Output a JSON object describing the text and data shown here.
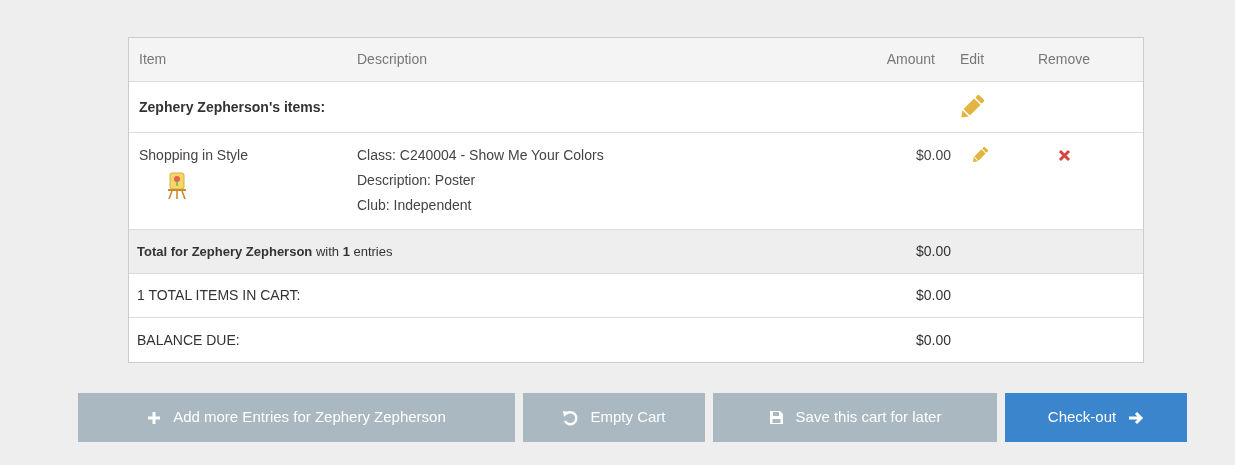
{
  "table": {
    "columns": [
      "Item",
      "Description",
      "Amount",
      "Edit",
      "Remove"
    ],
    "group": {
      "title": "Zephery Zepherson's items:"
    },
    "items": [
      {
        "name": "Shopping in Style",
        "details": [
          "Class: C240004 - Show Me Your Colors",
          "Description: Poster",
          "Club: Independent"
        ],
        "amount": "$0.00"
      }
    ],
    "summary": [
      {
        "kind": "subtotal",
        "label": "**Total for Zephery Zepherson** with **1** entries",
        "amount": "$0.00"
      },
      {
        "kind": "total",
        "label": "1 TOTAL ITEMS IN CART:",
        "amount": "$0.00"
      },
      {
        "kind": "total",
        "label": "BALANCE DUE:",
        "amount": "$0.00"
      }
    ]
  },
  "buttons": [
    {
      "kind": "add",
      "label": "Add more Entries for Zephery Zepherson"
    },
    {
      "kind": "empty",
      "label": "Empty Cart"
    },
    {
      "kind": "save",
      "label": "Save this cart for later"
    },
    {
      "kind": "checkout",
      "label": "Check-out"
    }
  ]
}
